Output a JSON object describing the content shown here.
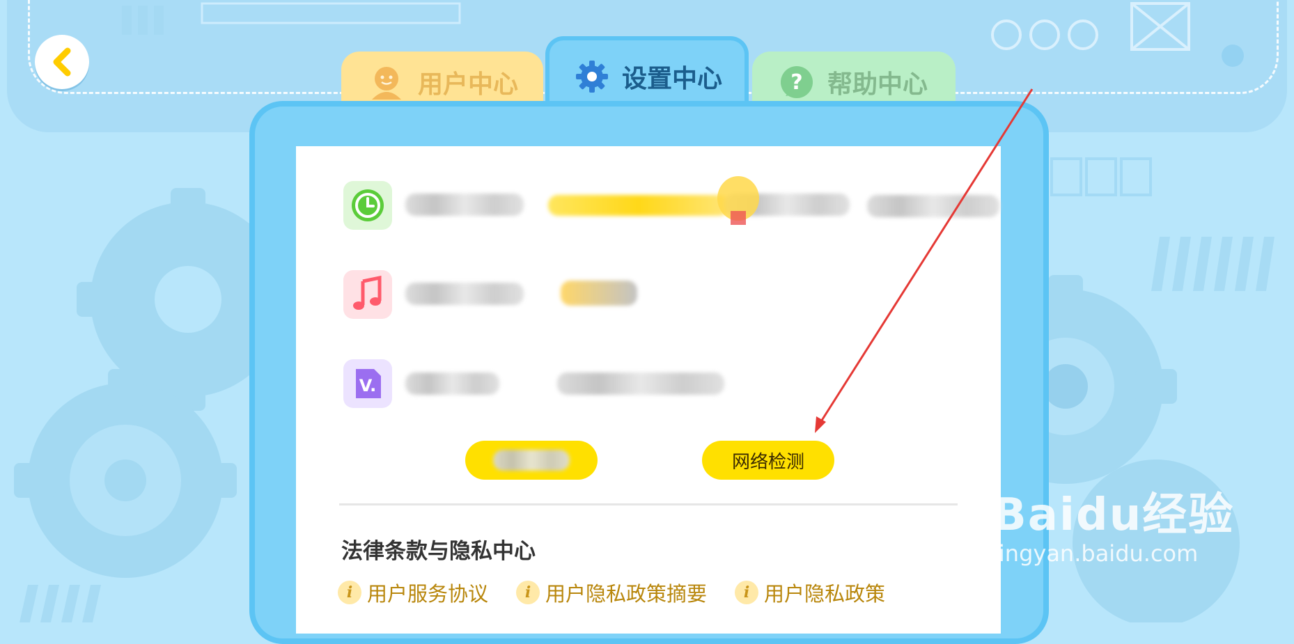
{
  "navigation": {
    "back_icon": "chevron-left-icon"
  },
  "tabs": [
    {
      "label": "用户中心",
      "icon": "avatar-face-icon",
      "active": false
    },
    {
      "label": "设置中心",
      "icon": "gear-icon",
      "active": true
    },
    {
      "label": "帮助中心",
      "icon": "question-icon",
      "active": false
    }
  ],
  "settings": {
    "rows": [
      {
        "icon": "clock-icon"
      },
      {
        "icon": "music-note-icon"
      },
      {
        "icon": "version-v-icon"
      }
    ],
    "buttons": {
      "network_check_label": "网络检测"
    }
  },
  "legal": {
    "title": "法律条款与隐私中心",
    "links": [
      {
        "label": "用户服务协议"
      },
      {
        "label": "用户隐私政策摘要"
      },
      {
        "label": "用户隐私政策"
      }
    ]
  },
  "watermark": {
    "brand": "Baidu经验",
    "url": "jingyan.baidu.com"
  },
  "colors": {
    "accent_yellow": "#ffe000",
    "panel_blue": "#7ed2f8",
    "annotation_red": "#e53935"
  }
}
